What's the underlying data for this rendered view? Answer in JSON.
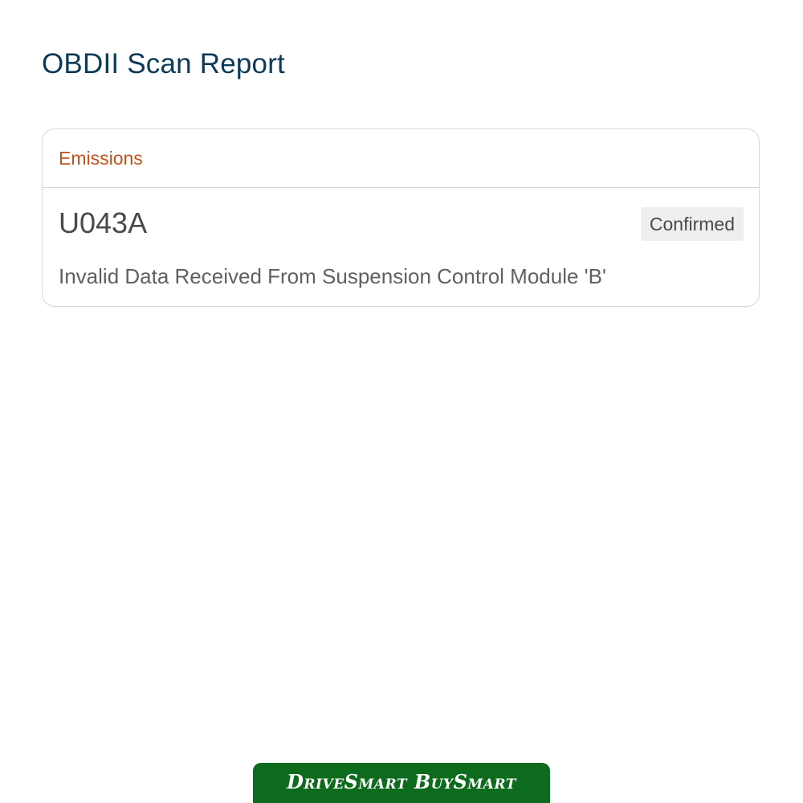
{
  "page": {
    "title": "OBDII Scan Report"
  },
  "codes": [
    {
      "category": "Emissions",
      "code": "U043A",
      "status": "Confirmed",
      "description": "Invalid Data Received From Suspension Control Module 'B'"
    }
  ],
  "footer": {
    "banner_text": "DriveSmart BuySmart"
  },
  "colors": {
    "title": "#0d3a57",
    "category": "#c8511a",
    "banner": "#0c6b1c",
    "badge_bg": "#eeeeef"
  }
}
